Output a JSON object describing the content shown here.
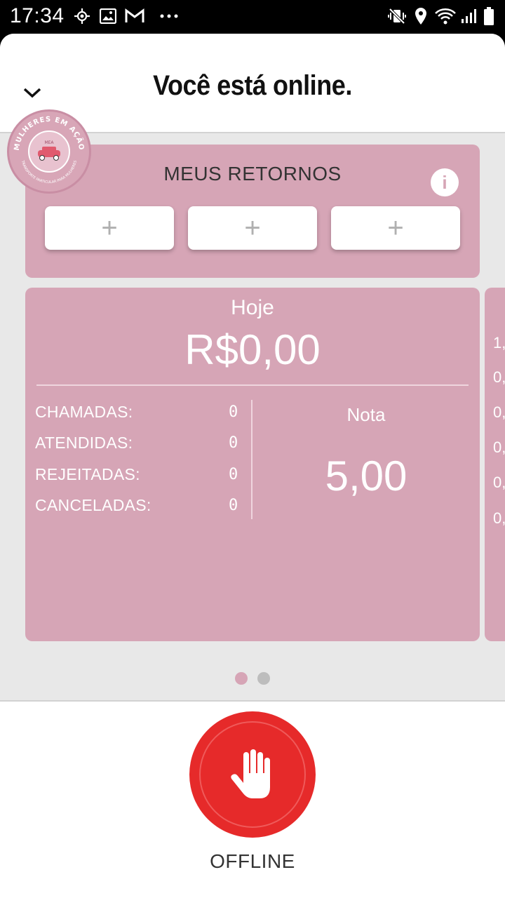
{
  "status_bar": {
    "time": "17:34",
    "icons": [
      "location-target-icon",
      "image-icon",
      "gmail-icon",
      "more-dots-icon",
      "vibrate-mute-icon",
      "location-pin-icon",
      "wifi-icon",
      "signal-icon",
      "battery-icon"
    ]
  },
  "header": {
    "title": "Você está online.",
    "collapse_icon": "chevron-down-icon"
  },
  "logo": {
    "text_top": "MULHERES EM AÇÃO",
    "text_bottom": "TRANSPORTE PARTICULAR PARA MULHERES",
    "badge": "MEA"
  },
  "retornos": {
    "title": "MEUS RETORNOS",
    "info_label": "i",
    "slots": [
      "+",
      "+",
      "+"
    ]
  },
  "stats": {
    "period": "Hoje",
    "amount": "R$0,00",
    "rows": [
      {
        "label": "CHAMADAS:",
        "value": "0"
      },
      {
        "label": "ATENDIDAS:",
        "value": "0"
      },
      {
        "label": "REJEITADAS:",
        "value": "0"
      },
      {
        "label": "CANCELADAS:",
        "value": "0"
      }
    ],
    "nota_label": "Nota",
    "nota_value": "5,00"
  },
  "next_card_peek": [
    "1,",
    "0,",
    "0,",
    "0,",
    "0,",
    "0,"
  ],
  "pager": {
    "pages": 2,
    "active": 0,
    "active_color": "#d6a5b6",
    "inactive_color": "#bdbdbd"
  },
  "offline_button": {
    "label": "OFFLINE",
    "color": "#e62a2a",
    "icon": "stop-hand-icon"
  },
  "colors": {
    "card": "#d6a5b6",
    "accent_red": "#e62a2a"
  }
}
